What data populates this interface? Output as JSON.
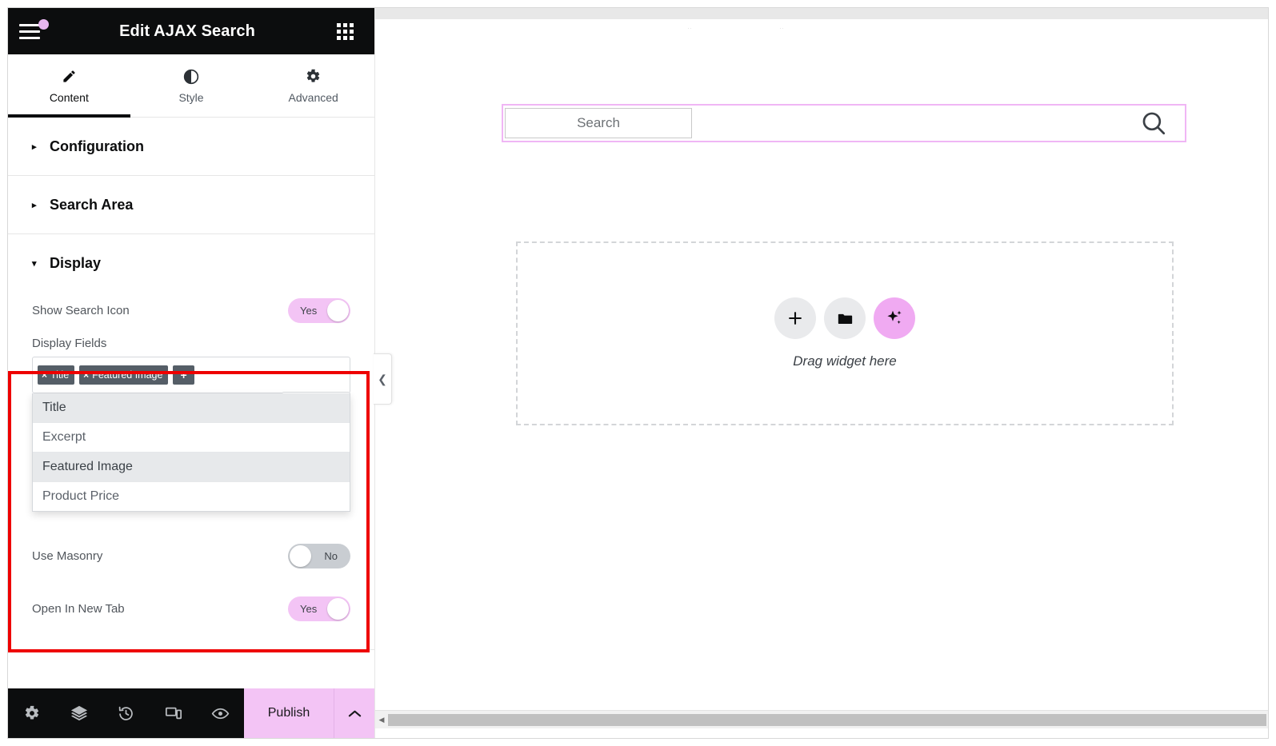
{
  "window": {
    "title": "Edit AJAX Search"
  },
  "panel": {
    "header": {
      "title": "Edit AJAX Search",
      "menu_icon": "hamburger-menu-icon",
      "apps_icon": "apps-grid-icon",
      "notification_dot": true
    },
    "tabs": [
      {
        "label": "Content",
        "icon": "pencil-icon",
        "active": true
      },
      {
        "label": "Style",
        "icon": "contrast-icon",
        "active": false
      },
      {
        "label": "Advanced",
        "icon": "gear-icon",
        "active": false
      }
    ],
    "sections": [
      {
        "label": "Configuration",
        "expanded": false,
        "caret": "▸"
      },
      {
        "label": "Search Area",
        "expanded": false,
        "caret": "▸"
      },
      {
        "label": "Display",
        "expanded": true,
        "caret": "▾"
      }
    ],
    "display": {
      "show_search_icon": {
        "label": "Show Search Icon",
        "value": "Yes",
        "state": "on"
      },
      "display_fields": {
        "label": "Display Fields",
        "chips": [
          {
            "label": "Title",
            "remove": "×"
          },
          {
            "label": "Featured Image",
            "remove": "×"
          }
        ],
        "add_label": "+",
        "options": [
          {
            "label": "Title",
            "selected": true
          },
          {
            "label": "Excerpt",
            "selected": false
          },
          {
            "label": "Featured Image",
            "selected": true
          },
          {
            "label": "Product Price",
            "selected": false
          }
        ]
      },
      "use_masonry": {
        "label": "Use Masonry",
        "value": "No",
        "state": "off"
      },
      "open_in_new_tab": {
        "label": "Open In New Tab",
        "value": "Yes",
        "state": "on"
      }
    },
    "collapse_handle": {
      "icon": "chevron-left-icon"
    },
    "footer": {
      "icons": [
        "settings-gear-icon",
        "layers-navigator-icon",
        "history-clock-icon",
        "responsive-devices-icon",
        "preview-eye-icon"
      ],
      "publish_label": "Publish",
      "publish_caret": "⌃"
    }
  },
  "canvas": {
    "search_widget": {
      "placeholder": "Search",
      "search_icon": "magnifier-icon",
      "selected": true
    },
    "dropzone": {
      "text": "Drag widget here",
      "buttons": [
        {
          "icon": "plus-icon",
          "variant": "default"
        },
        {
          "icon": "folder-icon",
          "variant": "default"
        },
        {
          "icon": "ai-sparkle-icon",
          "variant": "ai"
        }
      ]
    },
    "scrollbar": {
      "left_arrow": "◀"
    }
  },
  "colors": {
    "accent_pink": "#f3c4f5",
    "ai_pink": "#f0aaf2",
    "selection_border": "#f0b6f5",
    "annotation_red": "#ee0000",
    "header_dark": "#0c0d0e",
    "chip_gray": "#555e67"
  }
}
